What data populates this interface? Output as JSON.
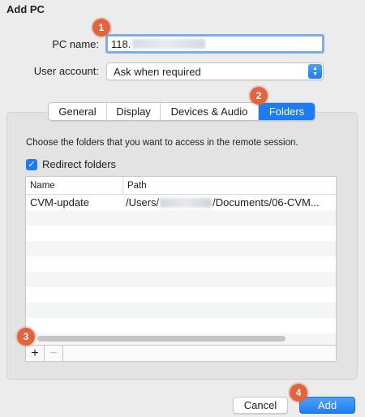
{
  "dialog": {
    "title": "Add PC"
  },
  "form": {
    "pc_name_label": "PC name:",
    "pc_name_value": "118.",
    "user_account_label": "User account:",
    "user_account_value": "Ask when required"
  },
  "tabs": [
    {
      "label": "General",
      "active": false
    },
    {
      "label": "Display",
      "active": false
    },
    {
      "label": "Devices & Audio",
      "active": false
    },
    {
      "label": "Folders",
      "active": true
    }
  ],
  "folders": {
    "description": "Choose the folders that you want to access in the remote session.",
    "redirect_label": "Redirect folders",
    "redirect_checked": true,
    "columns": {
      "name": "Name",
      "path": "Path"
    },
    "rows": [
      {
        "name": "CVM-update",
        "path_prefix": "/Users/",
        "path_suffix": "/Documents/06-CVM..."
      }
    ],
    "add_symbol": "+",
    "remove_symbol": "−"
  },
  "buttons": {
    "cancel": "Cancel",
    "add": "Add"
  },
  "callouts": [
    "1",
    "2",
    "3",
    "4"
  ],
  "colors": {
    "accent": "#1d7cf2",
    "callout": "#e0643d"
  }
}
